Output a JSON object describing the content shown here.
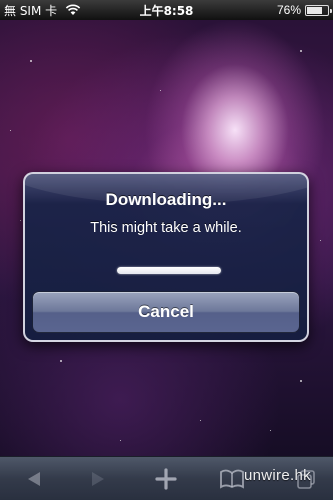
{
  "status_bar": {
    "carrier": "無 SIM 卡",
    "time": "上午8:58",
    "battery_percent_label": "76%",
    "battery_level": 0.76
  },
  "alert": {
    "title": "Downloading...",
    "message": "This might take a while.",
    "progress": 1.0,
    "cancel_label": "Cancel"
  },
  "toolbar": {
    "items": [
      "back-icon",
      "forward-icon",
      "add-icon",
      "bookmarks-icon",
      "pages-icon"
    ]
  },
  "watermark": "unwire.hk"
}
